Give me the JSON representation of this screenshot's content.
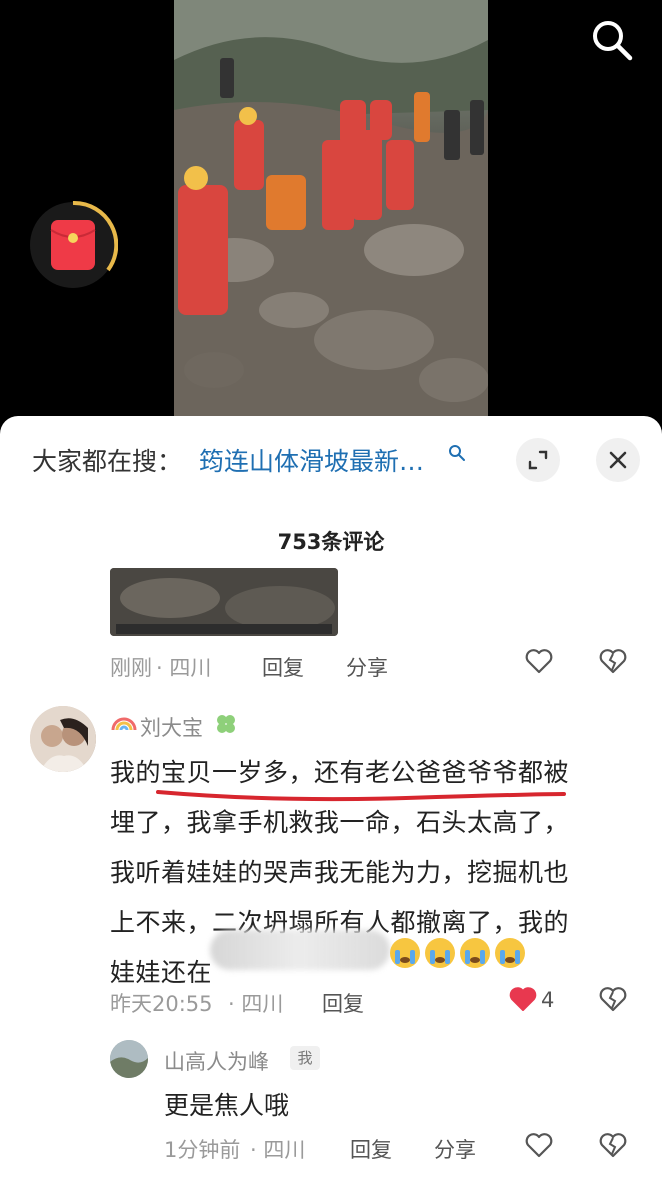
{
  "search": {
    "icon": "search-icon"
  },
  "redpacket": {
    "icon": "red-envelope-icon"
  },
  "sheet": {
    "search_prefix": "大家都在搜：",
    "search_term": "筠连山体滑坡最新…",
    "comment_count": "753条评论"
  },
  "comments": [
    {
      "time": "刚刚",
      "location": "· 四川",
      "reply_label": "回复",
      "share_label": "分享"
    },
    {
      "username": "刘大宝",
      "text_lines": [
        "我的宝贝一岁多，还有老公爸爸爷爷都被",
        "埋了，我拿手机救我一命，石头太高了，",
        "我听着娃娃的哭声我无能为力，挖掘机也",
        "上不来，二次坍塌所有人都撤离了，我的",
        "娃娃还在"
      ],
      "time": "昨天20:55",
      "location": "· 四川",
      "reply_label": "回复",
      "like_count": "4"
    },
    {
      "username": "山高人为峰",
      "badge": "我",
      "text": "更是焦人哦",
      "time": "1分钟前",
      "location": "· 四川",
      "reply_label": "回复",
      "share_label": "分享"
    }
  ],
  "colors": {
    "accent_blue": "#1f6fb2",
    "like_red": "#e8384f",
    "sheet_bg": "#ffffff"
  }
}
